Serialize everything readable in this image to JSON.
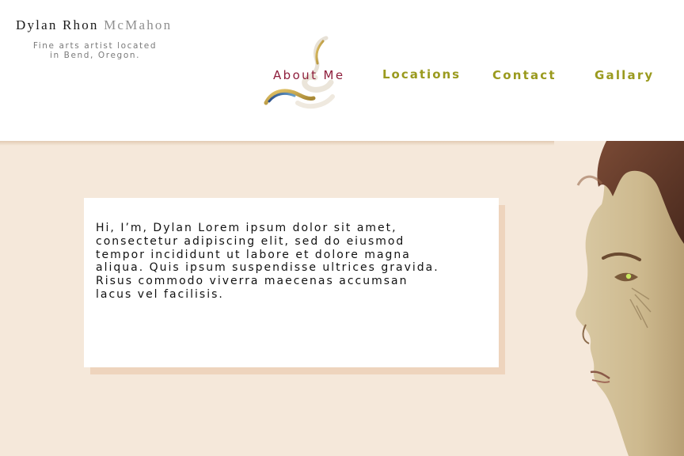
{
  "brand": {
    "first_name": "Dylan Rhon",
    "last_name": "McMahon",
    "tagline_line1": "Fine arts artist located",
    "tagline_line2": "in Bend, Oregon."
  },
  "nav": {
    "items": [
      {
        "label": "About Me",
        "active": true
      },
      {
        "label": "Locations"
      },
      {
        "label": "Contact"
      },
      {
        "label": "Gallary"
      }
    ]
  },
  "main": {
    "intro_text": "Hi, I’m, Dylan Lorem ipsum dolor sit amet,\nconsectetur adipiscing elit, sed do eiusmod\ntempor incididunt ut labore et dolore magna\naliqua. Quis ipsum suspendisse ultrices gravida.\nRisus commodo viverra maecenas accumsan\nlacus vel facilisis."
  },
  "colors": {
    "active_nav": "#8e1e3c",
    "nav": "#9a9a1e",
    "content_bg": "#f5e8da",
    "card_shadow": "#eed4bd"
  },
  "icons": {
    "logo": "swirl-logo-icon",
    "portrait": "portrait-illustration"
  }
}
